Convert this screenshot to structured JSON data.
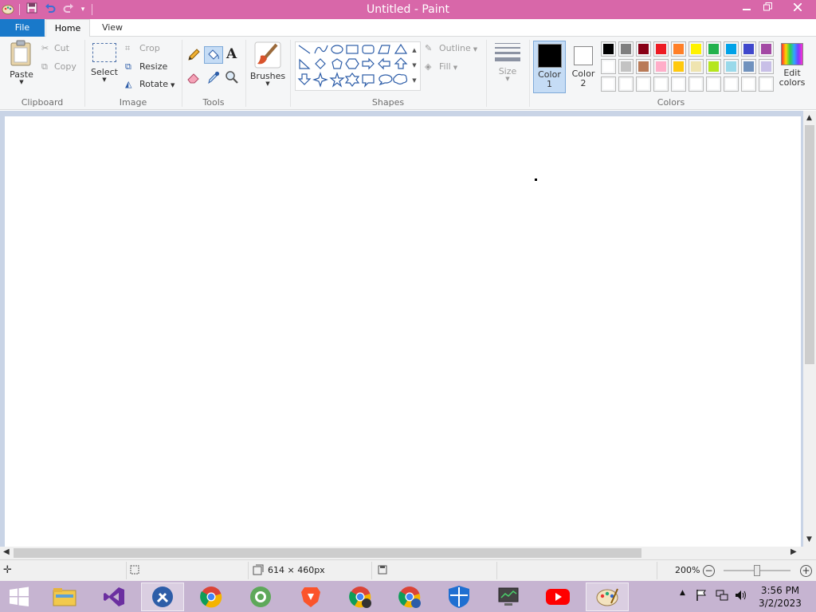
{
  "window": {
    "title": "Untitled - Paint"
  },
  "tabs": {
    "file": "File",
    "home": "Home",
    "view": "View"
  },
  "clipboard": {
    "paste": "Paste",
    "cut": "Cut",
    "copy": "Copy",
    "label": "Clipboard"
  },
  "image": {
    "select": "Select",
    "crop": "Crop",
    "resize": "Resize",
    "rotate": "Rotate",
    "label": "Image"
  },
  "tools": {
    "label": "Tools"
  },
  "brushes": {
    "label": "Brushes"
  },
  "shapes": {
    "outline": "Outline",
    "fill": "Fill",
    "label": "Shapes"
  },
  "size": {
    "label": "Size"
  },
  "colors": {
    "color1": "Color 1",
    "color2": "Color 2",
    "color1_value": "#000000",
    "color2_value": "#ffffff",
    "edit": "Edit colors",
    "label": "Colors",
    "palette_row1": [
      "#000000",
      "#7f7f7f",
      "#880015",
      "#ed1c24",
      "#ff7f27",
      "#fff200",
      "#22b14c",
      "#00a2e8",
      "#3f48cc",
      "#a349a4"
    ],
    "palette_row2": [
      "#ffffff",
      "#c3c3c3",
      "#b97a57",
      "#ffaec9",
      "#ffc90e",
      "#efe4b0",
      "#b5e61d",
      "#99d9ea",
      "#7092be",
      "#c8bfe7"
    ],
    "palette_row3": [
      "#ffffff",
      "#ffffff",
      "#ffffff",
      "#ffffff",
      "#ffffff",
      "#ffffff",
      "#ffffff",
      "#ffffff",
      "#ffffff",
      "#ffffff"
    ]
  },
  "status": {
    "dimensions": "614 × 460px",
    "zoom": "200%",
    "zoom_level": 0.5
  },
  "taskbar": {
    "time": "3:56 PM",
    "date": "3/2/2023",
    "apps": [
      "start",
      "file-explorer",
      "visual-studio",
      "tools",
      "chrome",
      "coccoc",
      "brave",
      "chrome-profile-b",
      "chrome-profile-r",
      "security",
      "monitor",
      "youtube",
      "paint"
    ]
  }
}
